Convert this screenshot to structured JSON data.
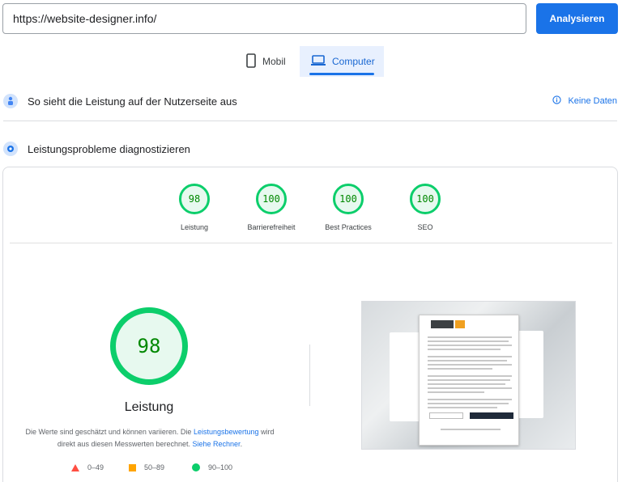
{
  "search": {
    "url": "https://website-designer.info/",
    "button_label": "Analysieren"
  },
  "tabs": [
    {
      "label": "Mobil",
      "icon": "phone-icon",
      "active": false
    },
    {
      "label": "Computer",
      "icon": "laptop-icon",
      "active": true
    }
  ],
  "field_data": {
    "title": "So sieht die Leistung auf der Nutzerseite aus",
    "no_data_label": "Keine Daten"
  },
  "diagnose": {
    "title": "Leistungsprobleme diagnostizieren"
  },
  "scores": [
    {
      "value": "98",
      "label": "Leistung"
    },
    {
      "value": "100",
      "label": "Barrierefreiheit"
    },
    {
      "value": "100",
      "label": "Best Practices"
    },
    {
      "value": "100",
      "label": "SEO"
    }
  ],
  "performance": {
    "score": "98",
    "label": "Leistung",
    "desc_part1": "Die Werte sind geschätzt und können variieren. Die ",
    "desc_link1": "Leistungsbewertung",
    "desc_part2": " wird direkt aus diesen Messwerten berechnet. ",
    "desc_link2": "Siehe Rechner",
    "desc_end": "."
  },
  "legend": [
    {
      "range": "0–49",
      "shape": "triangle",
      "color": "#ff4e42"
    },
    {
      "range": "50–89",
      "shape": "square",
      "color": "#ffa400"
    },
    {
      "range": "90–100",
      "shape": "circle",
      "color": "#0cce6b"
    }
  ],
  "colors": {
    "accent": "#1a73e8",
    "pass": "#0cce6b",
    "pass_text": "#008800"
  }
}
